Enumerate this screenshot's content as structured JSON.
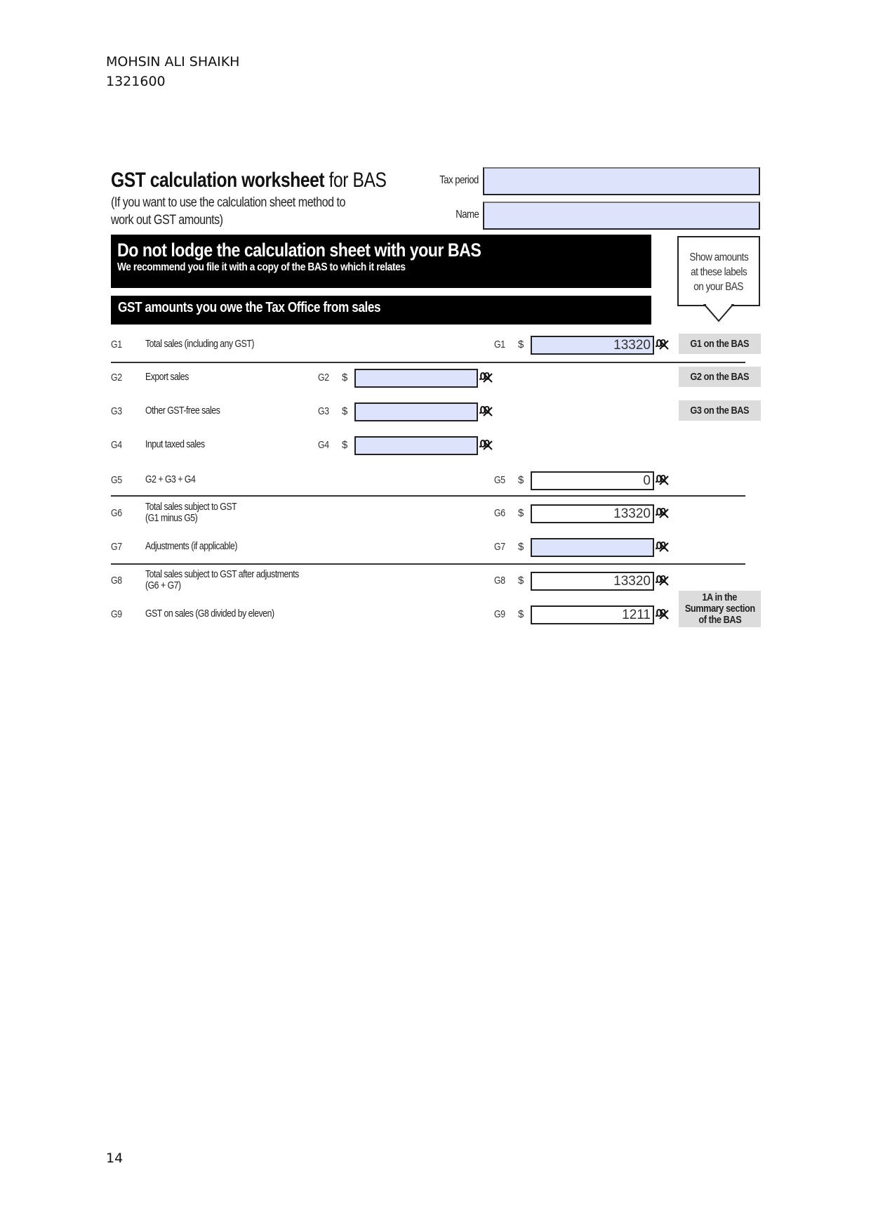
{
  "header": {
    "author_name": "MOHSIN ALI SHAIKH",
    "student_id": "1321600"
  },
  "form": {
    "title_bold": "GST calculation worksheet",
    "title_regular": " for BAS",
    "subtitle_line1": "(If you want to use the calculation sheet method to",
    "subtitle_line2": "work out GST amounts)",
    "tax_period_label": "Tax period",
    "tax_period_value": "",
    "name_label": "Name",
    "name_value": "",
    "warning_title": "Do not lodge the calculation sheet with your BAS",
    "warning_subtitle": "We recommend you file it with a copy of the BAS to which it relates",
    "section_title": "GST amounts you owe the Tax Office from sales",
    "callout_lines": [
      "Show amounts",
      "at these labels",
      "on your BAS"
    ],
    "currency_symbol": "$",
    "cents_glyph": ".00",
    "rows": [
      {
        "code": "G1",
        "description": "Total sales (including any GST)",
        "value": "13320",
        "bas_label": "G1 on the BAS"
      },
      {
        "code": "G2",
        "description": "Export sales",
        "value": "",
        "bas_label": "G2 on the BAS"
      },
      {
        "code": "G3",
        "description": "Other GST-free sales",
        "value": "",
        "bas_label": "G3 on the BAS"
      },
      {
        "code": "G4",
        "description": "Input taxed sales",
        "value": ""
      },
      {
        "code": "G5",
        "description": "G2 + G3 + G4",
        "value": "0"
      },
      {
        "code": "G6",
        "description": "Total sales subject to GST",
        "description2": "(G1 minus G5)",
        "value": "13320"
      },
      {
        "code": "G7",
        "description": "Adjustments (if applicable)",
        "value": ""
      },
      {
        "code": "G8",
        "description": "Total sales subject to GST after adjustments",
        "description2": "(G6 + G7)",
        "value": "13320"
      },
      {
        "code": "G9",
        "description": "GST on sales (G8 divided by eleven)",
        "value": "1211",
        "bas_label_lines": [
          "1A in the",
          "Summary section",
          "of the BAS"
        ]
      }
    ]
  },
  "footer": {
    "page_number": "14"
  },
  "colors": {
    "input_fill": "#dde3fb",
    "label_fill": "#dcdcdc",
    "banner": "#000000"
  }
}
